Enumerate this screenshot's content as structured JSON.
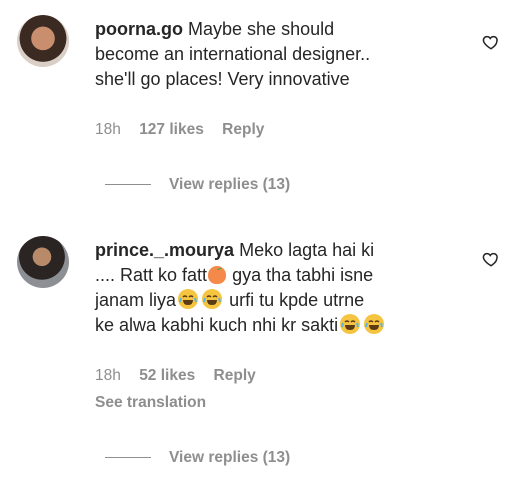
{
  "comments": [
    {
      "username": "poorna.go",
      "text_line1": "Maybe she should",
      "text_line2": "become an international designer..",
      "text_line3": "she'll go places! Very innovative",
      "time": "18h",
      "likes": "127 likes",
      "reply_label": "Reply",
      "view_replies": "View replies (13)"
    },
    {
      "username": "prince._.mourya",
      "text_line1": "Meko lagta hai ki",
      "text_line2a": ".... Ratt ko fatt",
      "text_line2b": "gya tha tabhi isne",
      "text_line3a": "janam liya",
      "text_line3b": "urfi tu kpde utrne",
      "text_line4": "ke alwa kabhi kuch nhi kr sakti",
      "time": "18h",
      "likes": "52 likes",
      "reply_label": "Reply",
      "see_translation": "See translation",
      "view_replies": "View replies (13)"
    }
  ],
  "icons": {
    "like": "heart-icon",
    "laugh": "face-with-tears-of-joy-emoji",
    "peach": "peach-emoji"
  }
}
